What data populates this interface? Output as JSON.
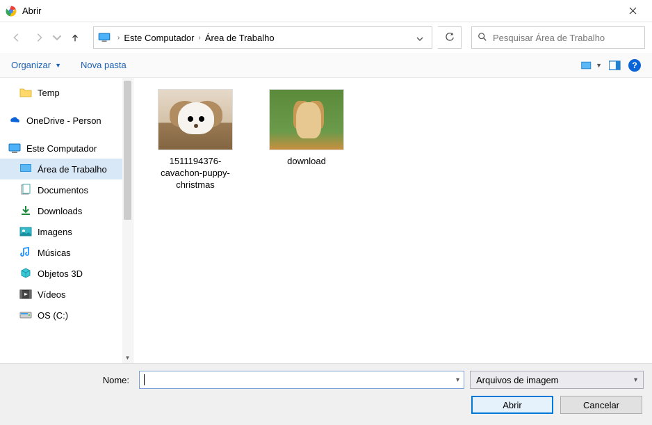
{
  "window": {
    "title": "Abrir"
  },
  "nav": {
    "breadcrumb": [
      "Este Computador",
      "Área de Trabalho"
    ]
  },
  "search": {
    "placeholder": "Pesquisar Área de Trabalho"
  },
  "toolbar": {
    "organize": "Organizar",
    "new_folder": "Nova pasta"
  },
  "sidebar": {
    "items": [
      {
        "label": "Temp",
        "icon": "folder"
      },
      {
        "label": "OneDrive - Person",
        "icon": "onedrive"
      },
      {
        "label": "Este Computador",
        "icon": "computer"
      },
      {
        "label": "Área de Trabalho",
        "icon": "desktop",
        "selected": true
      },
      {
        "label": "Documentos",
        "icon": "documents"
      },
      {
        "label": "Downloads",
        "icon": "downloads"
      },
      {
        "label": "Imagens",
        "icon": "images"
      },
      {
        "label": "Músicas",
        "icon": "music"
      },
      {
        "label": "Objetos 3D",
        "icon": "objects3d"
      },
      {
        "label": "Vídeos",
        "icon": "videos"
      },
      {
        "label": "OS (C:)",
        "icon": "disk"
      }
    ]
  },
  "files": [
    {
      "name": "1511194376-cavachon-puppy-christmas",
      "thumb": "puppy1"
    },
    {
      "name": "download",
      "thumb": "puppy2"
    }
  ],
  "footer": {
    "name_label": "Nome:",
    "name_value": "",
    "filter": "Arquivos de imagem",
    "open": "Abrir",
    "cancel": "Cancelar"
  }
}
